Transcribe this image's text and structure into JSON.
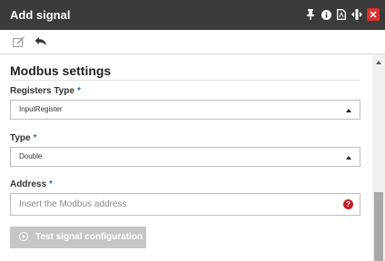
{
  "window": {
    "title": "Add signal",
    "icons": [
      "pin-icon",
      "info-icon",
      "pdf-icon",
      "resize-icon",
      "close-icon"
    ],
    "close_glyph": "×"
  },
  "toolbar": {
    "icons": [
      "edit-icon",
      "undo-icon"
    ]
  },
  "section": {
    "title": "Modbus settings"
  },
  "fields": {
    "registers_type": {
      "label": "Registers Type",
      "required": "*",
      "value": "InputRegister"
    },
    "type": {
      "label": "Type",
      "required": "*",
      "value": "Double"
    },
    "address": {
      "label": "Address",
      "required": "*",
      "value": "",
      "placeholder": "Insert the Modbus address",
      "help_glyph": "?"
    }
  },
  "actions": {
    "test_button_label": "Test signal configuration",
    "test_button_enabled": false
  },
  "colors": {
    "titlebar": "#3b3b3b",
    "close_button": "#d9312b",
    "required_marker": "#1a73c8",
    "help_icon": "#c81e1e",
    "disabled_button": "#c6c6c6"
  }
}
